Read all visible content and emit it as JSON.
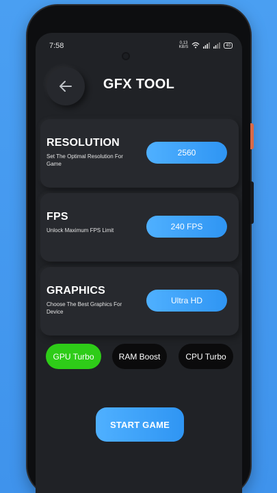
{
  "status_bar": {
    "time": "7:58",
    "speed_value": "0.13",
    "speed_unit": "KB/S",
    "battery": "40"
  },
  "header": {
    "back_icon": "arrow-left-icon",
    "title": "GFX TOOL"
  },
  "settings": [
    {
      "title": "RESOLUTION",
      "description": "Set The Optimal Resolution For Game",
      "value": "2560"
    },
    {
      "title": "FPS",
      "description": "Unlock Maximum FPS Limit",
      "value": "240 FPS"
    },
    {
      "title": "GRAPHICS",
      "description": "Choose The Best Graphics For Device",
      "value": "Ultra HD"
    }
  ],
  "boosts": {
    "gpu": "GPU Turbo",
    "ram": "RAM Boost",
    "cpu": "CPU Turbo"
  },
  "start_button": "START GAME",
  "colors": {
    "accent_blue": "#3aa0f7",
    "active_green": "#2ecc18",
    "background_blue": "#4a9ff2",
    "card_bg": "#27292e"
  }
}
